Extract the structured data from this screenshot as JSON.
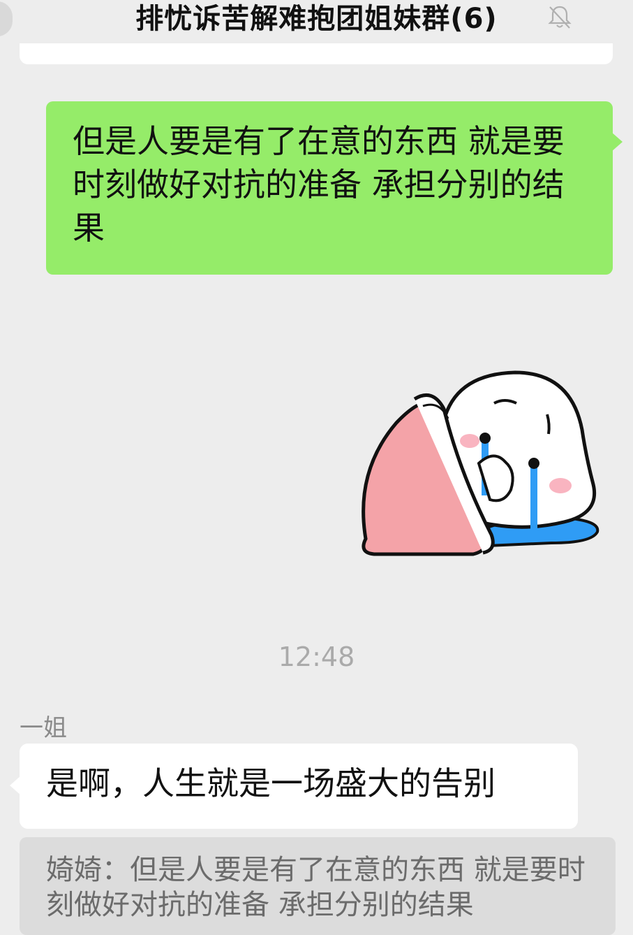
{
  "header": {
    "title": "排忧诉苦解难抱团姐妹群(6)",
    "mute_icon": "bell-slash-icon"
  },
  "messages": {
    "outgoing_text": "但是人要是有了在意的东西 就是要时刻做好对抗的准备 承担分别的结果",
    "sticker_icon": "crying-under-blanket-sticker",
    "timestamp": "12:48",
    "incoming_sender": "一姐",
    "incoming_text": "是啊，人生就是一场盛大的告别",
    "quote_sender": "婍婍：",
    "quote_text": "但是人要是有了在意的东西 就是要时刻做好对抗的准备 承担分别的结果"
  },
  "colors": {
    "chat_background": "#ededed",
    "outgoing_bubble": "#95ec69",
    "incoming_bubble": "#ffffff",
    "quote_background": "#dcdcdc"
  }
}
